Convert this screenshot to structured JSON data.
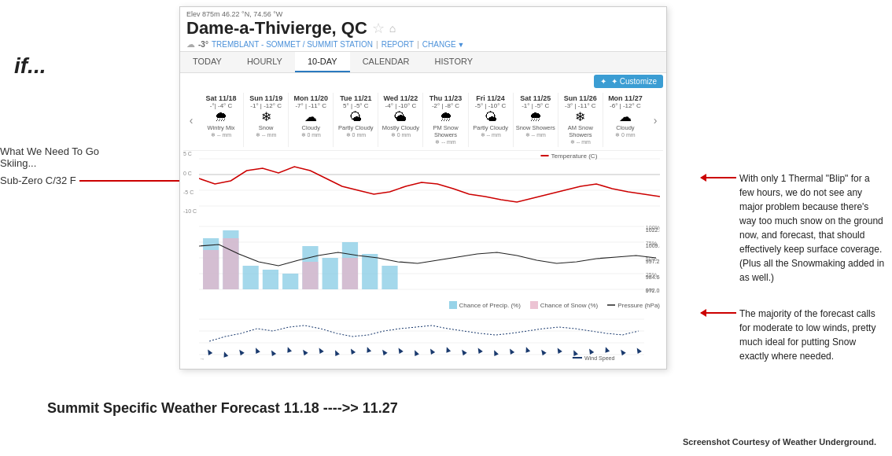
{
  "page": {
    "left_if": "if...",
    "left_label1": "What We Need To Go Skiing...",
    "left_label2": "Sub-Zero C/32 F",
    "right_text1": "With only 1 Thermal \"Blip\" for a few hours, we do not see any major problem because there's way too much snow on the ground now, and forecast, that should effectively keep surface coverage. (Plus all the Snowmaking added in as well.)",
    "right_text2": "The majority of the forecast calls for moderate to low winds, pretty much ideal for putting Snow exactly where needed.",
    "bottom_title": "Summit Specific Weather Forecast 11.18 ---->> 11.27",
    "bottom_credit": "Screenshot Courtesy of Weather Underground."
  },
  "widget": {
    "elev": "Elev 875m  46.22 °N, 74.56 °W",
    "title": "Dame-a-Thivierge, QC",
    "subtitle_temp": "-3°",
    "subtitle_station": "TREMBLANT - SOMMET / SUMMIT STATION",
    "report_label": "REPORT",
    "change_label": "CHANGE",
    "tabs": [
      "TODAY",
      "HOURLY",
      "10-DAY",
      "CALENDAR",
      "HISTORY"
    ],
    "active_tab": "10-DAY",
    "customize_label": "✦ Customize",
    "days": [
      {
        "name": "Sat 11/18",
        "temp": "-°| -4° C",
        "icon": "🌨",
        "desc": "Wintry Mix",
        "precip": "-- mm"
      },
      {
        "name": "Sun 11/19",
        "temp": "-1° | -12° C",
        "icon": "❄",
        "desc": "Snow",
        "precip": "-- mm"
      },
      {
        "name": "Mon 11/20",
        "temp": "-7° | -11° C",
        "icon": "☁",
        "desc": "Cloudy",
        "precip": "0 mm"
      },
      {
        "name": "Tue 11/21",
        "temp": "5° | -5° C",
        "icon": "🌤",
        "desc": "Partly Cloudy",
        "precip": "0 mm"
      },
      {
        "name": "Wed 11/22",
        "temp": "-4° | -10° C",
        "icon": "🌥",
        "desc": "Mostly Cloudy",
        "precip": "0 mm"
      },
      {
        "name": "Thu 11/23",
        "temp": "-2° | -8° C",
        "icon": "🌨",
        "desc": "PM Snow Showers",
        "precip": "-- mm"
      },
      {
        "name": "Fri 11/24",
        "temp": "-5° | -10° C",
        "icon": "🌤",
        "desc": "Partly Cloudy",
        "precip": "-- mm"
      },
      {
        "name": "Sat 11/25",
        "temp": "-1° | -5° C",
        "icon": "🌨",
        "desc": "Snow Showers",
        "precip": "-- mm"
      },
      {
        "name": "Sun 11/26",
        "temp": "-3° | -11° C",
        "icon": "❄",
        "desc": "AM Snow Showers",
        "precip": "-- mm"
      },
      {
        "name": "Mon 11/27",
        "temp": "-6° | -12° C",
        "icon": "☁",
        "desc": "Cloudy",
        "precip": "0 mm"
      }
    ],
    "temp_legend": "Temperature (C)",
    "chance_precip_legend": "Chance of Precip. (%)",
    "chance_snow_legend": "Chance of Snow (%)",
    "pressure_legend": "Pressure (hPa)",
    "wind_legend": "Wind Speed",
    "pressure_values": [
      "1022.4",
      "1009.8",
      "997.21",
      "984.64",
      "972.02"
    ],
    "temp_y_labels": [
      "5 C",
      "0 C",
      "-5 C",
      "-10 C"
    ]
  }
}
